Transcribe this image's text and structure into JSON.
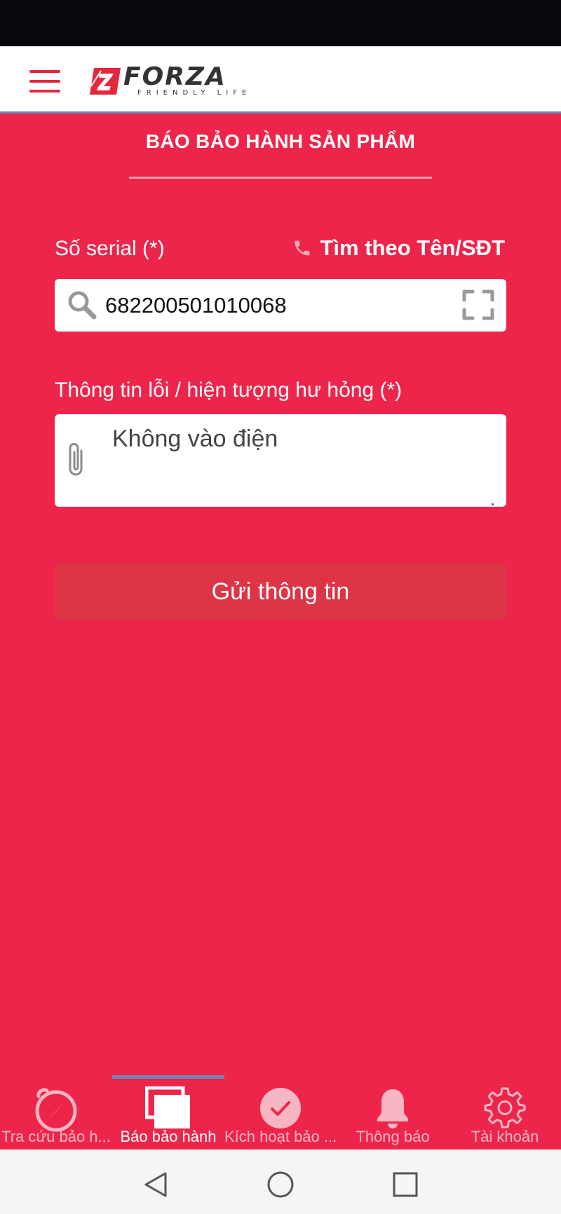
{
  "header": {
    "logo_word": "FORZA",
    "logo_tagline": "FRIENDLY LIFE"
  },
  "page": {
    "title": "BÁO BẢO HÀNH SẢN PHẨM"
  },
  "form": {
    "serial_label": "Số serial (*)",
    "find_link": "Tìm theo Tên/SĐT",
    "serial_value": "682200501010068",
    "fault_label": "Thông tin lỗi / hiện tượng hư hỏng (*)",
    "fault_value": "Không vào điện",
    "submit_label": "Gửi thông tin"
  },
  "tabs": [
    {
      "label": "Tra cứu bảo h...",
      "icon": "compass-icon",
      "active": false
    },
    {
      "label": "Báo bảo hành",
      "icon": "copy-icon",
      "active": true
    },
    {
      "label": "Kích hoạt bảo ...",
      "icon": "check-circle-icon",
      "active": false
    },
    {
      "label": "Thông báo",
      "icon": "bell-icon",
      "active": false
    },
    {
      "label": "Tài khoản",
      "icon": "gear-icon",
      "active": false
    }
  ],
  "colors": {
    "brand_red": "#EE254B",
    "button_red": "#DD3446",
    "tab_indicator": "#6E86B8"
  }
}
